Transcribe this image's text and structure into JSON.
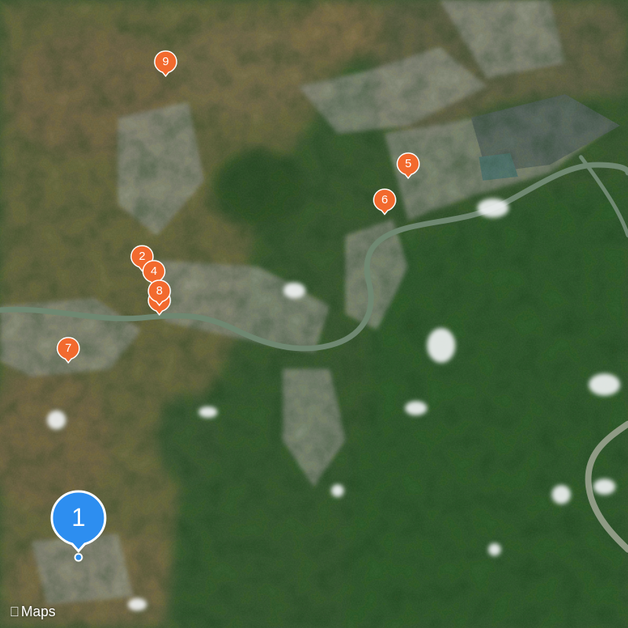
{
  "map": {
    "type": "satellite",
    "attribution": "Maps",
    "accent_color": "#f26a2e",
    "primary_color": "#2d8ef0",
    "pins": [
      {
        "label": "1",
        "kind": "primary",
        "icon": "location-pin-icon"
      },
      {
        "label": "2",
        "kind": "marker",
        "icon": "location-pin-icon"
      },
      {
        "label": "4",
        "kind": "marker",
        "icon": "location-pin-icon"
      },
      {
        "label": "8",
        "kind": "marker",
        "icon": "location-pin-icon"
      },
      {
        "label": "5",
        "kind": "marker",
        "icon": "location-pin-icon"
      },
      {
        "label": "6",
        "kind": "marker",
        "icon": "location-pin-icon"
      },
      {
        "label": "7",
        "kind": "marker",
        "icon": "location-pin-icon"
      },
      {
        "label": "9",
        "kind": "marker",
        "icon": "location-pin-icon"
      }
    ]
  }
}
